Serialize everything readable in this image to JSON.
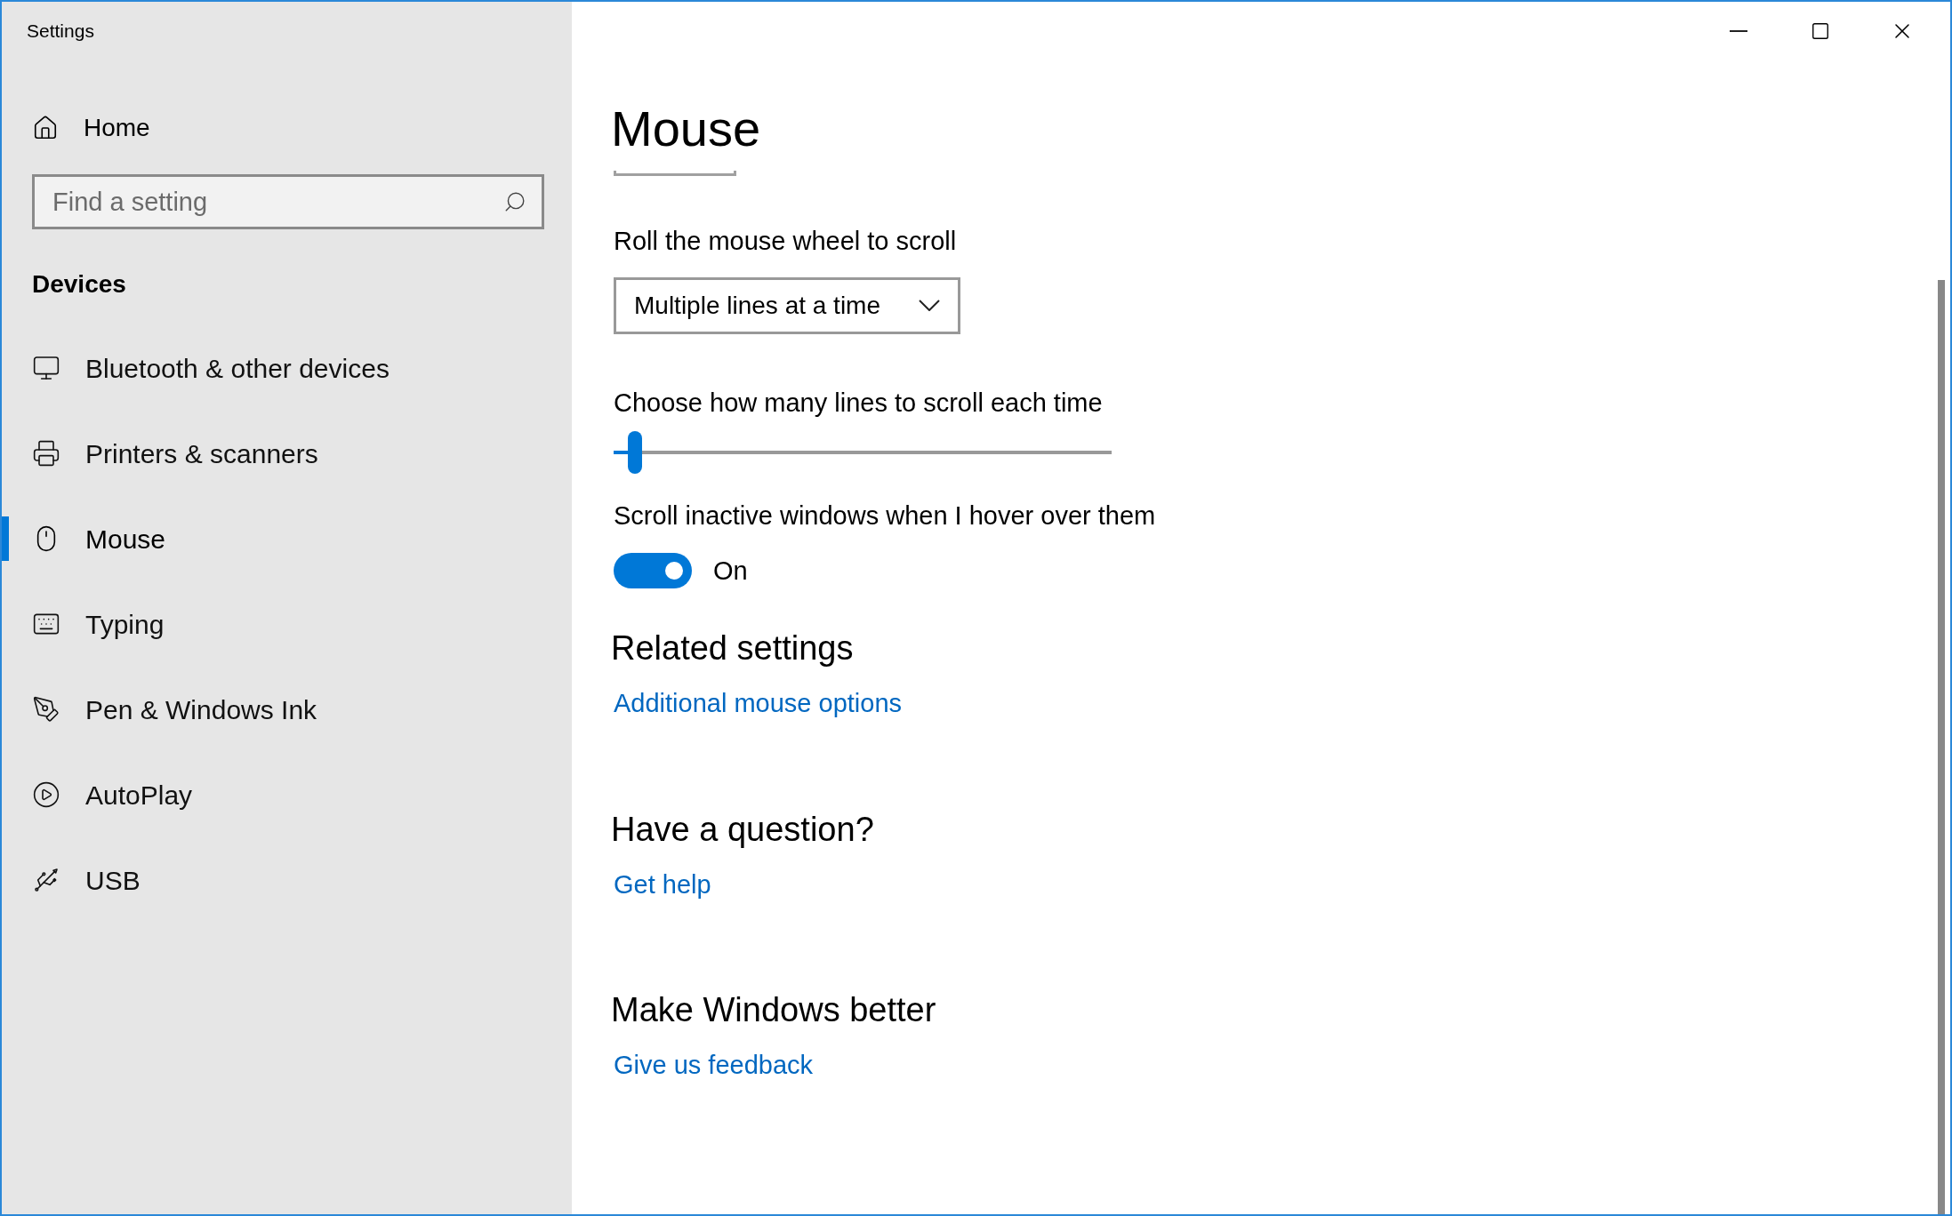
{
  "window": {
    "title": "Settings"
  },
  "sidebar": {
    "home": "Home",
    "search": {
      "placeholder": "Find a setting"
    },
    "section": "Devices",
    "items": [
      {
        "label": "Bluetooth & other devices",
        "selected": false
      },
      {
        "label": "Printers & scanners",
        "selected": false
      },
      {
        "label": "Mouse",
        "selected": true
      },
      {
        "label": "Typing",
        "selected": false
      },
      {
        "label": "Pen & Windows Ink",
        "selected": false
      },
      {
        "label": "AutoPlay",
        "selected": false
      },
      {
        "label": "USB",
        "selected": false
      }
    ]
  },
  "main": {
    "title": "Mouse",
    "wheel": {
      "label": "Roll the mouse wheel to scroll",
      "value": "Multiple lines at a time"
    },
    "lines": {
      "label": "Choose how many lines to scroll each time",
      "level": 0.03
    },
    "inactive": {
      "label": "Scroll inactive windows when I hover over them",
      "on": true,
      "state_text": "On"
    },
    "sections": [
      {
        "heading": "Related settings",
        "link": "Additional mouse options"
      },
      {
        "heading": "Have a question?",
        "link": "Get help"
      },
      {
        "heading": "Make Windows better",
        "link": "Give us feedback"
      }
    ]
  }
}
